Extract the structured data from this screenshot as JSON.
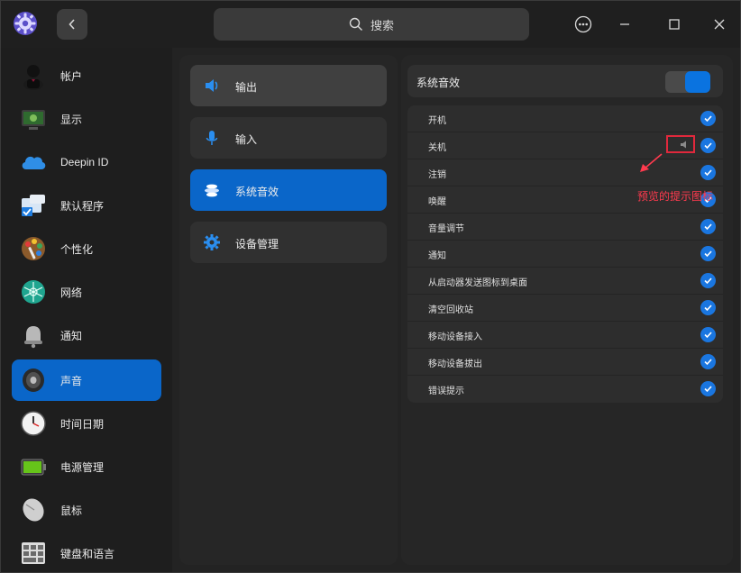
{
  "titlebar": {
    "search_label": "搜索",
    "app_icon": "settings-gear-icon",
    "back_icon": "chevron-left-icon",
    "menu_icon": "more-icon",
    "minimize_icon": "minimize-icon",
    "maximize_icon": "maximize-icon",
    "close_icon": "close-icon"
  },
  "sidebar": {
    "items": [
      {
        "label": "帐户",
        "icon": "account-icon"
      },
      {
        "label": "显示",
        "icon": "display-icon"
      },
      {
        "label": "Deepin ID",
        "icon": "cloud-icon"
      },
      {
        "label": "默认程序",
        "icon": "default-apps-icon"
      },
      {
        "label": "个性化",
        "icon": "personalization-icon"
      },
      {
        "label": "网络",
        "icon": "network-icon"
      },
      {
        "label": "通知",
        "icon": "bell-icon"
      },
      {
        "label": "声音",
        "icon": "speaker-icon",
        "active": true
      },
      {
        "label": "时间日期",
        "icon": "clock-icon"
      },
      {
        "label": "电源管理",
        "icon": "battery-icon"
      },
      {
        "label": "鼠标",
        "icon": "mouse-icon"
      },
      {
        "label": "键盘和语言",
        "icon": "keyboard-icon"
      }
    ]
  },
  "middle": {
    "items": [
      {
        "label": "输出",
        "icon": "speaker-output-icon"
      },
      {
        "label": "输入",
        "icon": "microphone-icon"
      },
      {
        "label": "系统音效",
        "icon": "sound-effects-icon",
        "active": true
      },
      {
        "label": "设备管理",
        "icon": "gear-icon"
      }
    ]
  },
  "content": {
    "header_title": "系统音效",
    "toggle_on": true,
    "effects": [
      {
        "label": "开机",
        "checked": true
      },
      {
        "label": "关机",
        "checked": true
      },
      {
        "label": "注销",
        "checked": true
      },
      {
        "label": "唤醒",
        "checked": true
      },
      {
        "label": "音量调节",
        "checked": true
      },
      {
        "label": "通知",
        "checked": true
      },
      {
        "label": "从启动器发送图标到桌面",
        "checked": true
      },
      {
        "label": "清空回收站",
        "checked": true
      },
      {
        "label": "移动设备接入",
        "checked": true
      },
      {
        "label": "移动设备拔出",
        "checked": true
      },
      {
        "label": "错误提示",
        "checked": true
      }
    ],
    "annotation": "预览的提示图标"
  },
  "colors": {
    "accent": "#0a66c9",
    "annotation": "#ff3a4e"
  }
}
